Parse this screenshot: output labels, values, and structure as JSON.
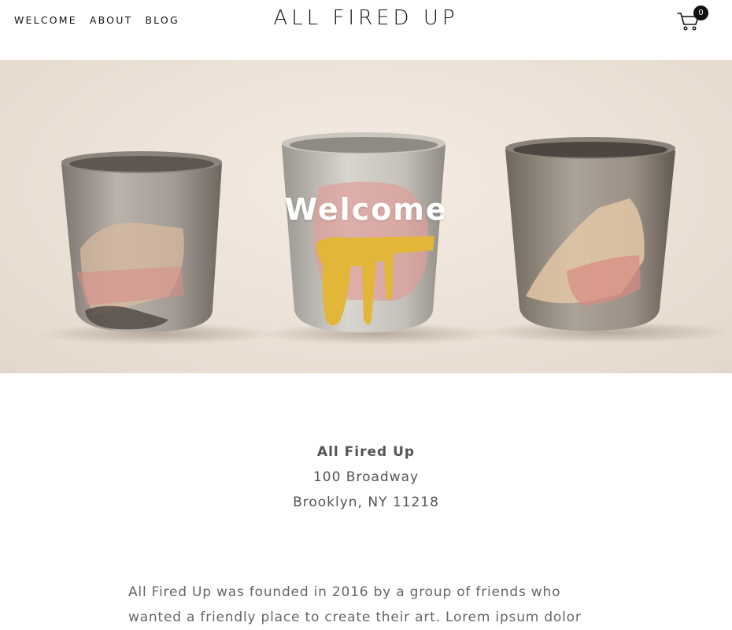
{
  "nav": {
    "items": [
      {
        "label": "WELCOME"
      },
      {
        "label": "ABOUT"
      },
      {
        "label": "BLOG"
      }
    ]
  },
  "site": {
    "title": "ALL FIRED UP"
  },
  "cart": {
    "count": "0",
    "icon": "cart-icon"
  },
  "hero": {
    "heading": "Welcome"
  },
  "address": {
    "name": "All Fired Up",
    "street": "100 Broadway",
    "city": "Brooklyn, NY 11218"
  },
  "about": {
    "text": "All Fired Up was founded in 2016 by a group of friends who wanted a friendly place to create their art. Lorem ipsum dolor"
  },
  "colors": {
    "text": "#111111",
    "hero_bg": "#ece1d6",
    "body_text": "#666666"
  }
}
